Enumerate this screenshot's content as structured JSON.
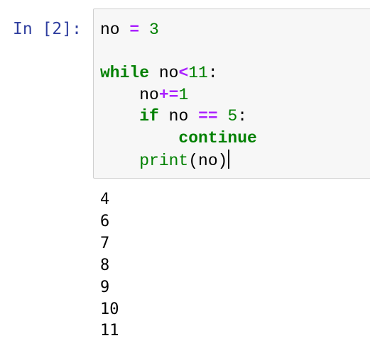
{
  "cell": {
    "prompt": "In [2]:",
    "code": {
      "line1": {
        "var": "no",
        "op": "=",
        "num": "3"
      },
      "line3": {
        "kw": "while",
        "var": "no",
        "op": "<",
        "num": "11",
        "colon": ":"
      },
      "line4": {
        "indent": "    ",
        "var": "no",
        "op": "+=",
        "num": "1"
      },
      "line5": {
        "indent": "    ",
        "kw": "if",
        "var": "no",
        "op": "==",
        "num": "5",
        "colon": ":"
      },
      "line6": {
        "indent": "        ",
        "kw": "continue"
      },
      "line7": {
        "indent": "    ",
        "func": "print",
        "open": "(",
        "arg": "no",
        "close": ")"
      }
    },
    "output": [
      "4",
      "6",
      "7",
      "8",
      "9",
      "10",
      "11"
    ]
  },
  "colors": {
    "prompt": "#303f9f",
    "keyword": "#008000",
    "operator": "#aa22ff",
    "number": "#008000",
    "cell_background": "#f7f7f7",
    "cell_border": "#cfcfcf"
  }
}
